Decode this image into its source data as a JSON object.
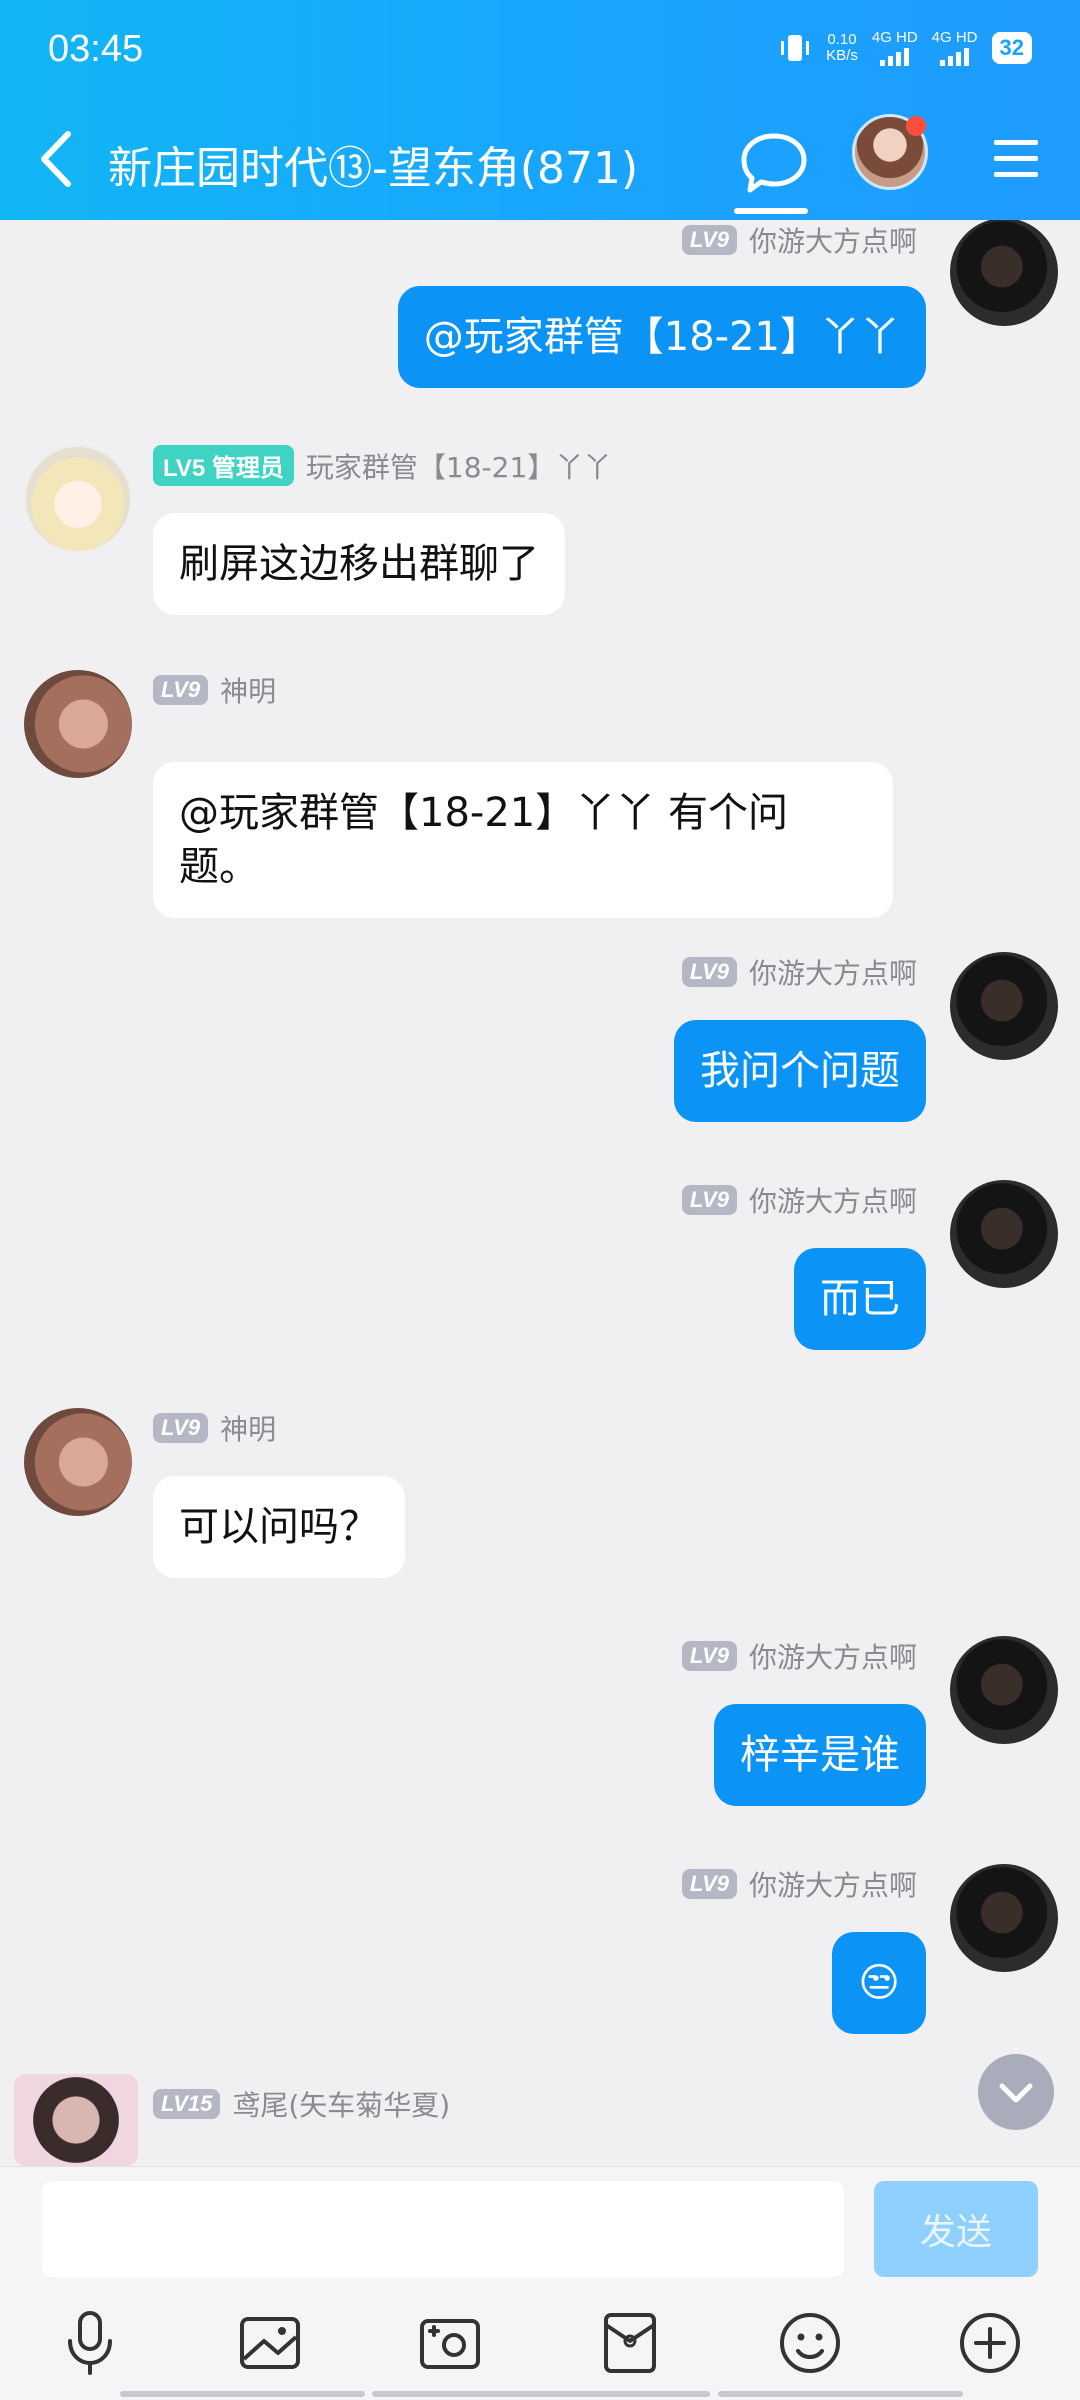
{
  "status": {
    "time": "03:45",
    "net_speed_value": "0.10",
    "net_speed_unit": "KB/s",
    "sim1": "4G HD",
    "sim2": "4G HD",
    "battery": "32"
  },
  "header": {
    "title": "新庄园时代⑬-望东角(871)"
  },
  "messages": [
    {
      "user": "你游大方点啊",
      "level": "LV9",
      "text": "@玩家群管【18-21】丫丫"
    },
    {
      "user": "玩家群管【18-21】丫丫",
      "level": "LV5 管理员",
      "text": "刷屏这边移出群聊了"
    },
    {
      "user": "神明",
      "level": "LV9",
      "text": "@玩家群管【18-21】丫丫 有个问题。"
    },
    {
      "user": "你游大方点啊",
      "level": "LV9",
      "text": "我问个问题"
    },
    {
      "user": "你游大方点啊",
      "level": "LV9",
      "text": "而已"
    },
    {
      "user": "神明",
      "level": "LV9",
      "text": "可以问吗？"
    },
    {
      "user": "你游大方点啊",
      "level": "LV9",
      "text": "梓辛是谁"
    },
    {
      "user": "你游大方点啊",
      "level": "LV9",
      "text": "😒"
    },
    {
      "user": "鸢尾(矢车菊华夏)",
      "level": "LV15",
      "text": ""
    }
  ],
  "input": {
    "placeholder": "",
    "send_label": "发送"
  },
  "colors": {
    "header": "#1aa3ff",
    "outgoing_bubble": "#0b93f6",
    "incoming_bubble": "#ffffff",
    "chat_bg": "#f0f0f2"
  },
  "icons": [
    "back-icon",
    "chat-icon",
    "menu-icon",
    "mic-icon",
    "image-icon",
    "camera-icon",
    "red-packet-icon",
    "emoji-icon",
    "plus-icon",
    "chevron-down-icon"
  ]
}
